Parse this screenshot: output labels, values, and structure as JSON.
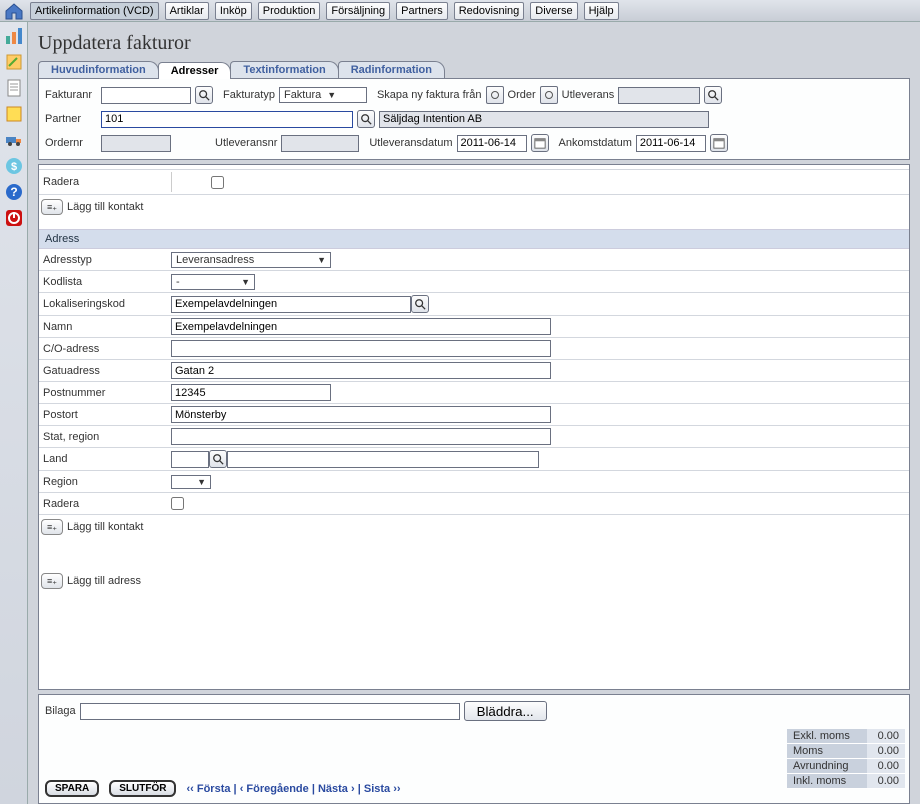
{
  "menu": {
    "items": [
      "Artikelinformation (VCD)",
      "Artiklar",
      "Inköp",
      "Produktion",
      "Försäljning",
      "Partners",
      "Redovisning",
      "Diverse",
      "Hjälp"
    ]
  },
  "title": "Uppdatera fakturor",
  "tabs": [
    "Huvudinformation",
    "Adresser",
    "Textinformation",
    "Radinformation"
  ],
  "header": {
    "fakturanr_label": "Fakturanr",
    "fakturatyp_label": "Fakturatyp",
    "fakturatyp_value": "Faktura",
    "skapa_label": "Skapa ny faktura från",
    "order_label": "Order",
    "utlev_label": "Utleverans",
    "partner_label": "Partner",
    "partner_value": "101",
    "partner_name": "Säljdag Intention AB",
    "ordernr_label": "Ordernr",
    "utleveransnr_label": "Utleveransnr",
    "utleveransdatum_label": "Utleveransdatum",
    "utleveransdatum_value": "2011-06-14",
    "ankomstdatum_label": "Ankomstdatum",
    "ankomstdatum_value": "2011-06-14"
  },
  "address": {
    "radera_label": "Radera",
    "add_contact_label": "Lägg till kontakt",
    "section_title": "Adress",
    "adresstyp_label": "Adresstyp",
    "adresstyp_value": "Leveransadress",
    "kodlista_label": "Kodlista",
    "kodlista_value": "-",
    "lokaliseringskod_label": "Lokaliseringskod",
    "lokaliseringskod_value": "Exempelavdelningen",
    "namn_label": "Namn",
    "namn_value": "Exempelavdelningen",
    "co_label": "C/O-adress",
    "co_value": "",
    "gatu_label": "Gatuadress",
    "gatu_value": "Gatan 2",
    "postnr_label": "Postnummer",
    "postnr_value": "12345",
    "postort_label": "Postort",
    "postort_value": "Mönsterby",
    "stat_label": "Stat, region",
    "stat_value": "",
    "land_label": "Land",
    "region_label": "Region",
    "add_address_label": "Lägg till adress"
  },
  "footer": {
    "bilaga_label": "Bilaga",
    "browse_label": "Bläddra...",
    "spara": "SPARA",
    "slutfor": "SLUTFÖR",
    "nav_first": "‹‹ Första",
    "nav_prev": "‹ Föregående",
    "nav_next": "Nästa ›",
    "nav_last": "Sista ››",
    "totals": [
      {
        "label": "Exkl. moms",
        "value": "0.00"
      },
      {
        "label": "Moms",
        "value": "0.00"
      },
      {
        "label": "Avrundning",
        "value": "0.00"
      },
      {
        "label": "Inkl. moms",
        "value": "0.00"
      }
    ]
  }
}
